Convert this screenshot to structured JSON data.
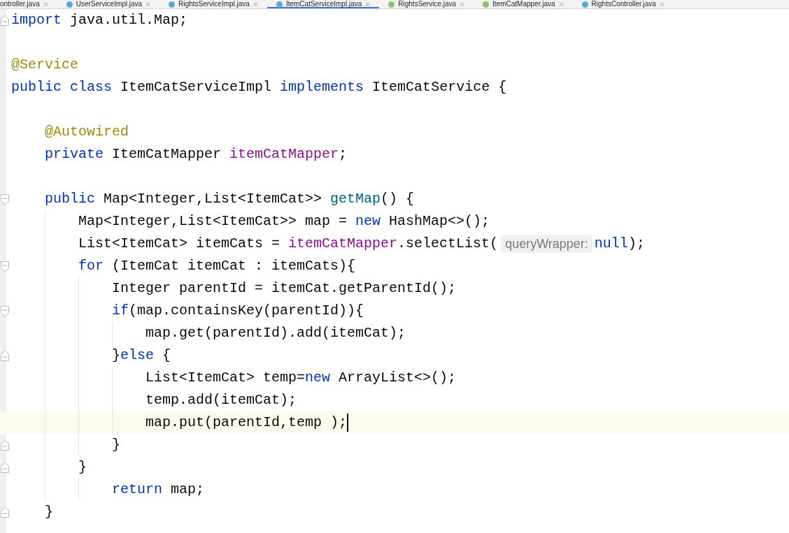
{
  "tabs": [
    {
      "label": "ontroller.java",
      "selected": false
    },
    {
      "label": "UserServiceImpl.java",
      "color": "#5aa8d8",
      "selected": false
    },
    {
      "label": "RightsServiceImpl.java",
      "color": "#5aa8d8",
      "selected": false
    },
    {
      "label": "ItemCatServiceImpl.java",
      "color": "#5aa8d8",
      "selected": true
    },
    {
      "label": "RightsService.java",
      "color": "#8bc26a",
      "selected": false
    },
    {
      "label": "ItemCatMapper.java",
      "color": "#8bc26a",
      "selected": false
    },
    {
      "label": "RightsController.java",
      "color": "#5aa8d8",
      "selected": false
    }
  ],
  "lines": [
    {
      "kind": "closing",
      "tokens": [
        {
          "text": "import",
          "kind": "keyword"
        },
        {
          "text": " java.util.Map;",
          "kind": "plain"
        }
      ],
      "current": false
    },
    {
      "kind": "plain",
      "current": false
    },
    {
      "kind": "plain",
      "tokens": [
        {
          "text": "@Service",
          "kind": "annotation"
        }
      ],
      "current": false
    },
    {
      "kind": "plain",
      "tokens": [
        {
          "text": "public class",
          "kind": "keyword"
        },
        {
          "text": " ItemCatServiceImpl ",
          "kind": "plain"
        },
        {
          "text": "implements",
          "kind": "keyword"
        },
        {
          "text": " ItemCatService {",
          "kind": "plain"
        }
      ],
      "current": false
    },
    {
      "kind": "plain",
      "current": false
    },
    {
      "kind": "plain",
      "tokens": [
        {
          "text": "    @Autowired",
          "kind": "annotation"
        }
      ],
      "current": false
    },
    {
      "kind": "plain",
      "tokens": [
        {
          "text": "    private",
          "kind": "keyword"
        },
        {
          "text": " ItemCatMapper ",
          "kind": "plain"
        },
        {
          "text": "itemCatMapper",
          "kind": "field"
        },
        {
          "text": ";",
          "kind": "plain"
        }
      ],
      "current": false
    },
    {
      "kind": "plain",
      "current": false
    },
    {
      "kind": "opening",
      "tokens": [
        {
          "text": "    public",
          "kind": "keyword"
        },
        {
          "text": " Map<Integer,List<ItemCat>> ",
          "kind": "plain"
        },
        {
          "text": "getMap",
          "kind": "method"
        },
        {
          "text": "() {",
          "kind": "plain"
        }
      ],
      "current": false
    },
    {
      "kind": "plain",
      "tokens": [
        {
          "text": "        Map<Integer,List<ItemCat>> map = ",
          "kind": "plain"
        },
        {
          "text": "new",
          "kind": "keyword"
        },
        {
          "text": " HashMap<>();",
          "kind": "plain"
        }
      ],
      "current": false
    },
    {
      "kind": "plain",
      "tokens": [
        {
          "text": "        List<ItemCat> itemCats = ",
          "kind": "plain"
        },
        {
          "text": "itemCatMapper",
          "kind": "field"
        },
        {
          "text": ".selectList(",
          "kind": "plain"
        },
        {
          "text": "queryWrapper:",
          "kind": "hint"
        },
        {
          "text": "null",
          "kind": "keyword"
        },
        {
          "text": ");",
          "kind": "plain"
        }
      ],
      "current": false
    },
    {
      "kind": "opening",
      "tokens": [
        {
          "text": "        for",
          "kind": "keyword"
        },
        {
          "text": " (ItemCat itemCat : itemCats){",
          "kind": "plain"
        }
      ],
      "current": false
    },
    {
      "kind": "plain",
      "tokens": [
        {
          "text": "            Integer parentId = itemCat.getParentId();",
          "kind": "plain"
        }
      ],
      "current": false
    },
    {
      "kind": "opening",
      "tokens": [
        {
          "text": "            if",
          "kind": "keyword"
        },
        {
          "text": "(map.containsKey(parentId)){",
          "kind": "plain"
        }
      ],
      "current": false
    },
    {
      "kind": "plain",
      "tokens": [
        {
          "text": "                map.get(parentId).add(itemCat);",
          "kind": "plain"
        }
      ],
      "current": false
    },
    {
      "kind": "closing",
      "tokens": [
        {
          "text": "            }",
          "kind": "plain"
        },
        {
          "text": "else",
          "kind": "keyword"
        },
        {
          "text": " {",
          "kind": "plain"
        }
      ],
      "current": false
    },
    {
      "kind": "plain",
      "tokens": [
        {
          "text": "                List<ItemCat> temp=",
          "kind": "plain"
        },
        {
          "text": "new",
          "kind": "keyword"
        },
        {
          "text": " ArrayList<>();",
          "kind": "plain"
        }
      ],
      "current": false
    },
    {
      "kind": "plain",
      "tokens": [
        {
          "text": "                temp.add(itemCat);",
          "kind": "plain"
        }
      ],
      "current": false
    },
    {
      "kind": "plain",
      "tokens": [
        {
          "text": "                map.put(parentId,temp );",
          "kind": "plain"
        }
      ],
      "current": true
    },
    {
      "kind": "closing",
      "tokens": [
        {
          "text": "            }",
          "kind": "plain"
        }
      ],
      "current": false
    },
    {
      "kind": "closing",
      "tokens": [
        {
          "text": "        }",
          "kind": "plain"
        }
      ],
      "current": false
    },
    {
      "kind": "plain",
      "tokens": [
        {
          "text": "            return",
          "kind": "keyword"
        },
        {
          "text": " map;",
          "kind": "plain"
        }
      ],
      "current": false
    },
    {
      "kind": "closing",
      "tokens": [
        {
          "text": "    }",
          "kind": "plain"
        }
      ],
      "current": false
    }
  ]
}
